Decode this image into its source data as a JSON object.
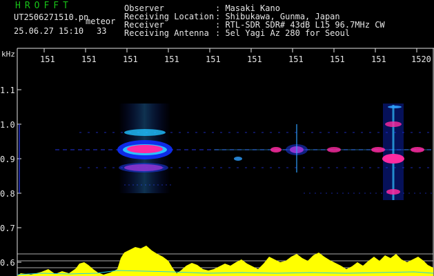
{
  "header": {
    "app_title": "HROFFT",
    "file_name": "UT2506271510.pn",
    "file_suffix": "meteor",
    "date_time": "25.06.27 15:10",
    "count": "33"
  },
  "info": [
    {
      "label": "Observer",
      "value": ": Masaki Kano"
    },
    {
      "label": "Receiving Location",
      "value": ": Shibukawa, Gunma, Japan"
    },
    {
      "label": "Receiver",
      "value": ": RTL-SDR SDR# 43dB L15 96.7MHz CW"
    },
    {
      "label": "Receiving Antenna",
      "value": ": 5el Yagi Az 280 for Seoul"
    }
  ],
  "axis": {
    "y_unit": "kHz",
    "x_labels": [
      "151",
      "151",
      "151",
      "151",
      "151",
      "151",
      "151",
      "151",
      "151",
      "1520"
    ],
    "y_labels": [
      "1.1",
      "1.0",
      "0.9",
      "0.8",
      "0.7",
      "0.6"
    ]
  },
  "colors": {
    "background": "#000000",
    "title_green": "#18c018",
    "signal_yellow": "#ffff00",
    "noise_cyan": "#20d0e0",
    "core_magenta": "#ff2aa0"
  }
}
